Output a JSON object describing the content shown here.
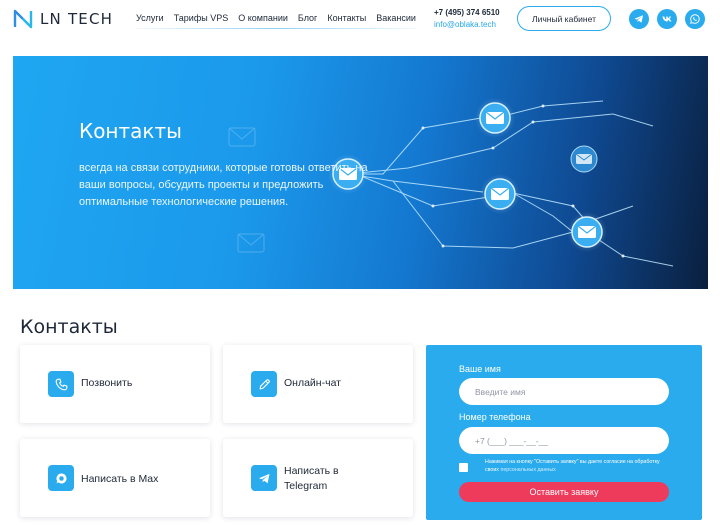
{
  "header": {
    "logo_text": "LN TECH",
    "nav": [
      "Услуги",
      "Тарифы VPS",
      "О компании",
      "Блог",
      "Контакты",
      "Вакансии"
    ],
    "phone": "+7 (495) 374 6510",
    "email": "info@oblaka.tech",
    "cabinet_button": "Личный кабинет",
    "social_icons": [
      "telegram-icon",
      "vk-icon",
      "whatsapp-icon"
    ]
  },
  "banner": {
    "title": "Контакты",
    "text": "всегда на связи сотрудники, которые готовы ответить на ваши вопросы, обсудить проекты и предложить оптимальные технологические решения."
  },
  "section": {
    "title": "Контакты",
    "cards": [
      {
        "label": "Позвонить",
        "icon": "phone-icon"
      },
      {
        "label": "Онлайн-чат",
        "icon": "pencil-icon"
      },
      {
        "label": "Написать в Max",
        "icon": "max-chat-icon"
      },
      {
        "label": "Написать в Telegram",
        "icon": "telegram-icon"
      }
    ]
  },
  "form": {
    "name_label": "Ваше имя",
    "name_placeholder": "Введите имя",
    "phone_label": "Номер телефона",
    "phone_placeholder": "+7 (___) ___-__-__",
    "consent_text": "Нажимая на кнопку \"Оставить заявку\" вы даете согласие на обработку своих",
    "consent_link": "персональных данных",
    "submit_label": "Оставить заявку"
  },
  "colors": {
    "accent": "#2aabee",
    "submit": "#ee3a5b",
    "text": "#1e2838"
  }
}
